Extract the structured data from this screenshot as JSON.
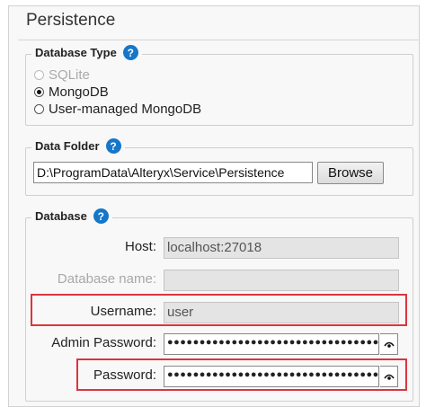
{
  "panel": {
    "title": "Persistence"
  },
  "database_type": {
    "legend": "Database Type",
    "options": [
      {
        "label": "SQLite",
        "state": "disabled"
      },
      {
        "label": "MongoDB",
        "state": "checked"
      },
      {
        "label": "User-managed MongoDB",
        "state": "unchecked"
      }
    ]
  },
  "data_folder": {
    "legend": "Data Folder",
    "path_value": "D:\\ProgramData\\Alteryx\\Service\\Persistence",
    "browse_label": "Browse"
  },
  "database": {
    "legend": "Database",
    "host_label": "Host:",
    "host_value": "localhost:27018",
    "dbname_label": "Database name:",
    "dbname_value": "",
    "username_label": "Username:",
    "username_value": "user",
    "admin_password_label": "Admin Password:",
    "admin_password_value": "●●●●●●●●●●●●●●●●●●●●●●●●●●●●●●●●●●●",
    "password_label": "Password:",
    "password_value": "●●●●●●●●●●●●●●●●●●●●●●●●●●●●●●●●●●●"
  },
  "icons": {
    "help": "help-icon",
    "reveal_password": "eye-icon"
  },
  "help_glyph": "?",
  "colors": {
    "help_blue": "#1677c9",
    "highlight_red": "#d9363e"
  }
}
